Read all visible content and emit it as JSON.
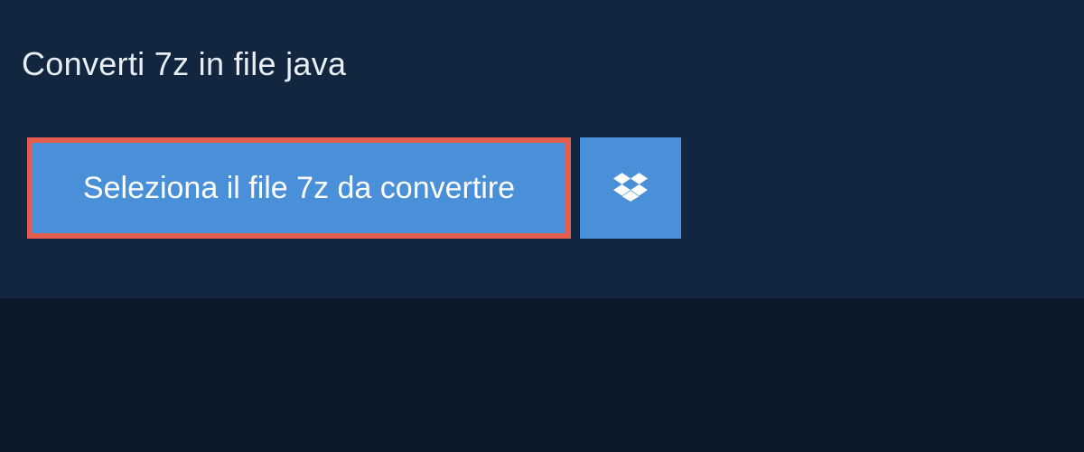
{
  "header": {
    "title": "Converti 7z in file java"
  },
  "actions": {
    "select_file_label": "Seleziona il file 7z da convertire",
    "dropbox_icon": "dropbox-icon"
  },
  "colors": {
    "background": "#0a1929",
    "panel": "#12273f",
    "button_primary": "#4a90d9",
    "highlight_border": "#e35c4e",
    "text_light": "#e8eef5"
  }
}
